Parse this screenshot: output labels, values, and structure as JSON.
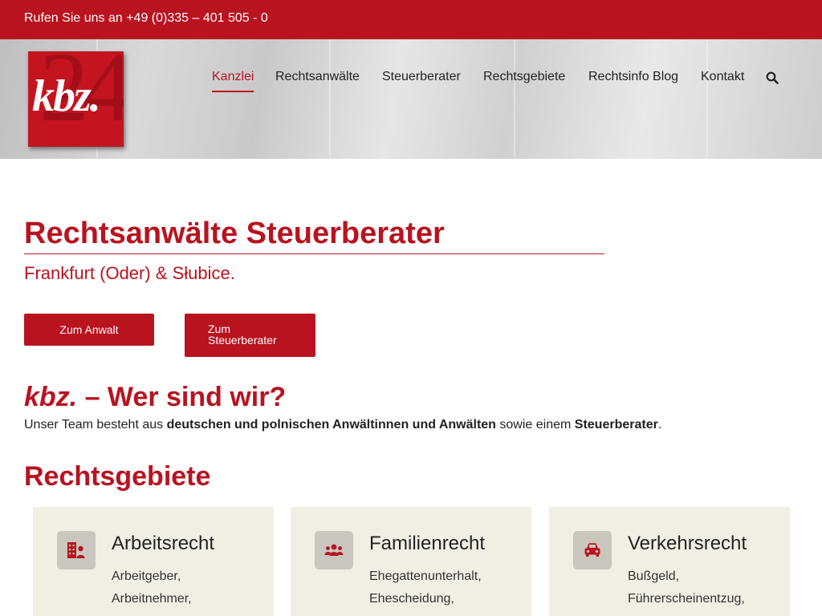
{
  "topbar": {
    "phone_text": "Rufen Sie uns an +49 (0)335 – 401 505 - 0"
  },
  "logo": {
    "word": "kbz.",
    "number": "24",
    "brand_color": "#c41420"
  },
  "nav": {
    "items": [
      {
        "label": "Kanzlei",
        "active": true
      },
      {
        "label": "Rechtsanwälte",
        "active": false
      },
      {
        "label": "Steuerberater",
        "active": false
      },
      {
        "label": "Rechtsgebiete",
        "active": false
      },
      {
        "label": "Rechtsinfo Blog",
        "active": false
      },
      {
        "label": "Kontakt",
        "active": false
      }
    ],
    "search_icon": "search-icon"
  },
  "hero": {
    "title": "Rechtsanwälte Steuerberater",
    "subtitle": "Frankfurt (Oder) & Słubice.",
    "btn_anwalt": "Zum Anwalt",
    "btn_steuer_line1": "Zum",
    "btn_steuer_line2": "Steuerberater"
  },
  "who": {
    "brand": "kbz.",
    "heading_rest": " – Wer sind wir?",
    "intro_1": "Unser Team besteht aus ",
    "intro_bold_1": "deutschen und polnischen Anwältinnen und Anwälten",
    "intro_2": " sowie einem ",
    "intro_bold_2": "Steuerberater",
    "intro_3": "."
  },
  "rechtsgebiete": {
    "heading": "Rechtsgebiete",
    "cards": [
      {
        "title": "Arbeitsrecht",
        "icon": "building-user-icon",
        "lines": [
          "Arbeitgeber,",
          "Arbeitnehmer,"
        ]
      },
      {
        "title": "Familienrecht",
        "icon": "family-group-icon",
        "lines": [
          "Ehegattenunterhalt,",
          "Ehescheidung,"
        ]
      },
      {
        "title": "Verkehrsrecht",
        "icon": "car-icon",
        "lines": [
          "Bußgeld,",
          "Führerscheinentzug,"
        ]
      }
    ]
  },
  "colors": {
    "accent": "#b8131f",
    "card_bg": "#f1efe3",
    "icon_box": "#c9c7be"
  }
}
